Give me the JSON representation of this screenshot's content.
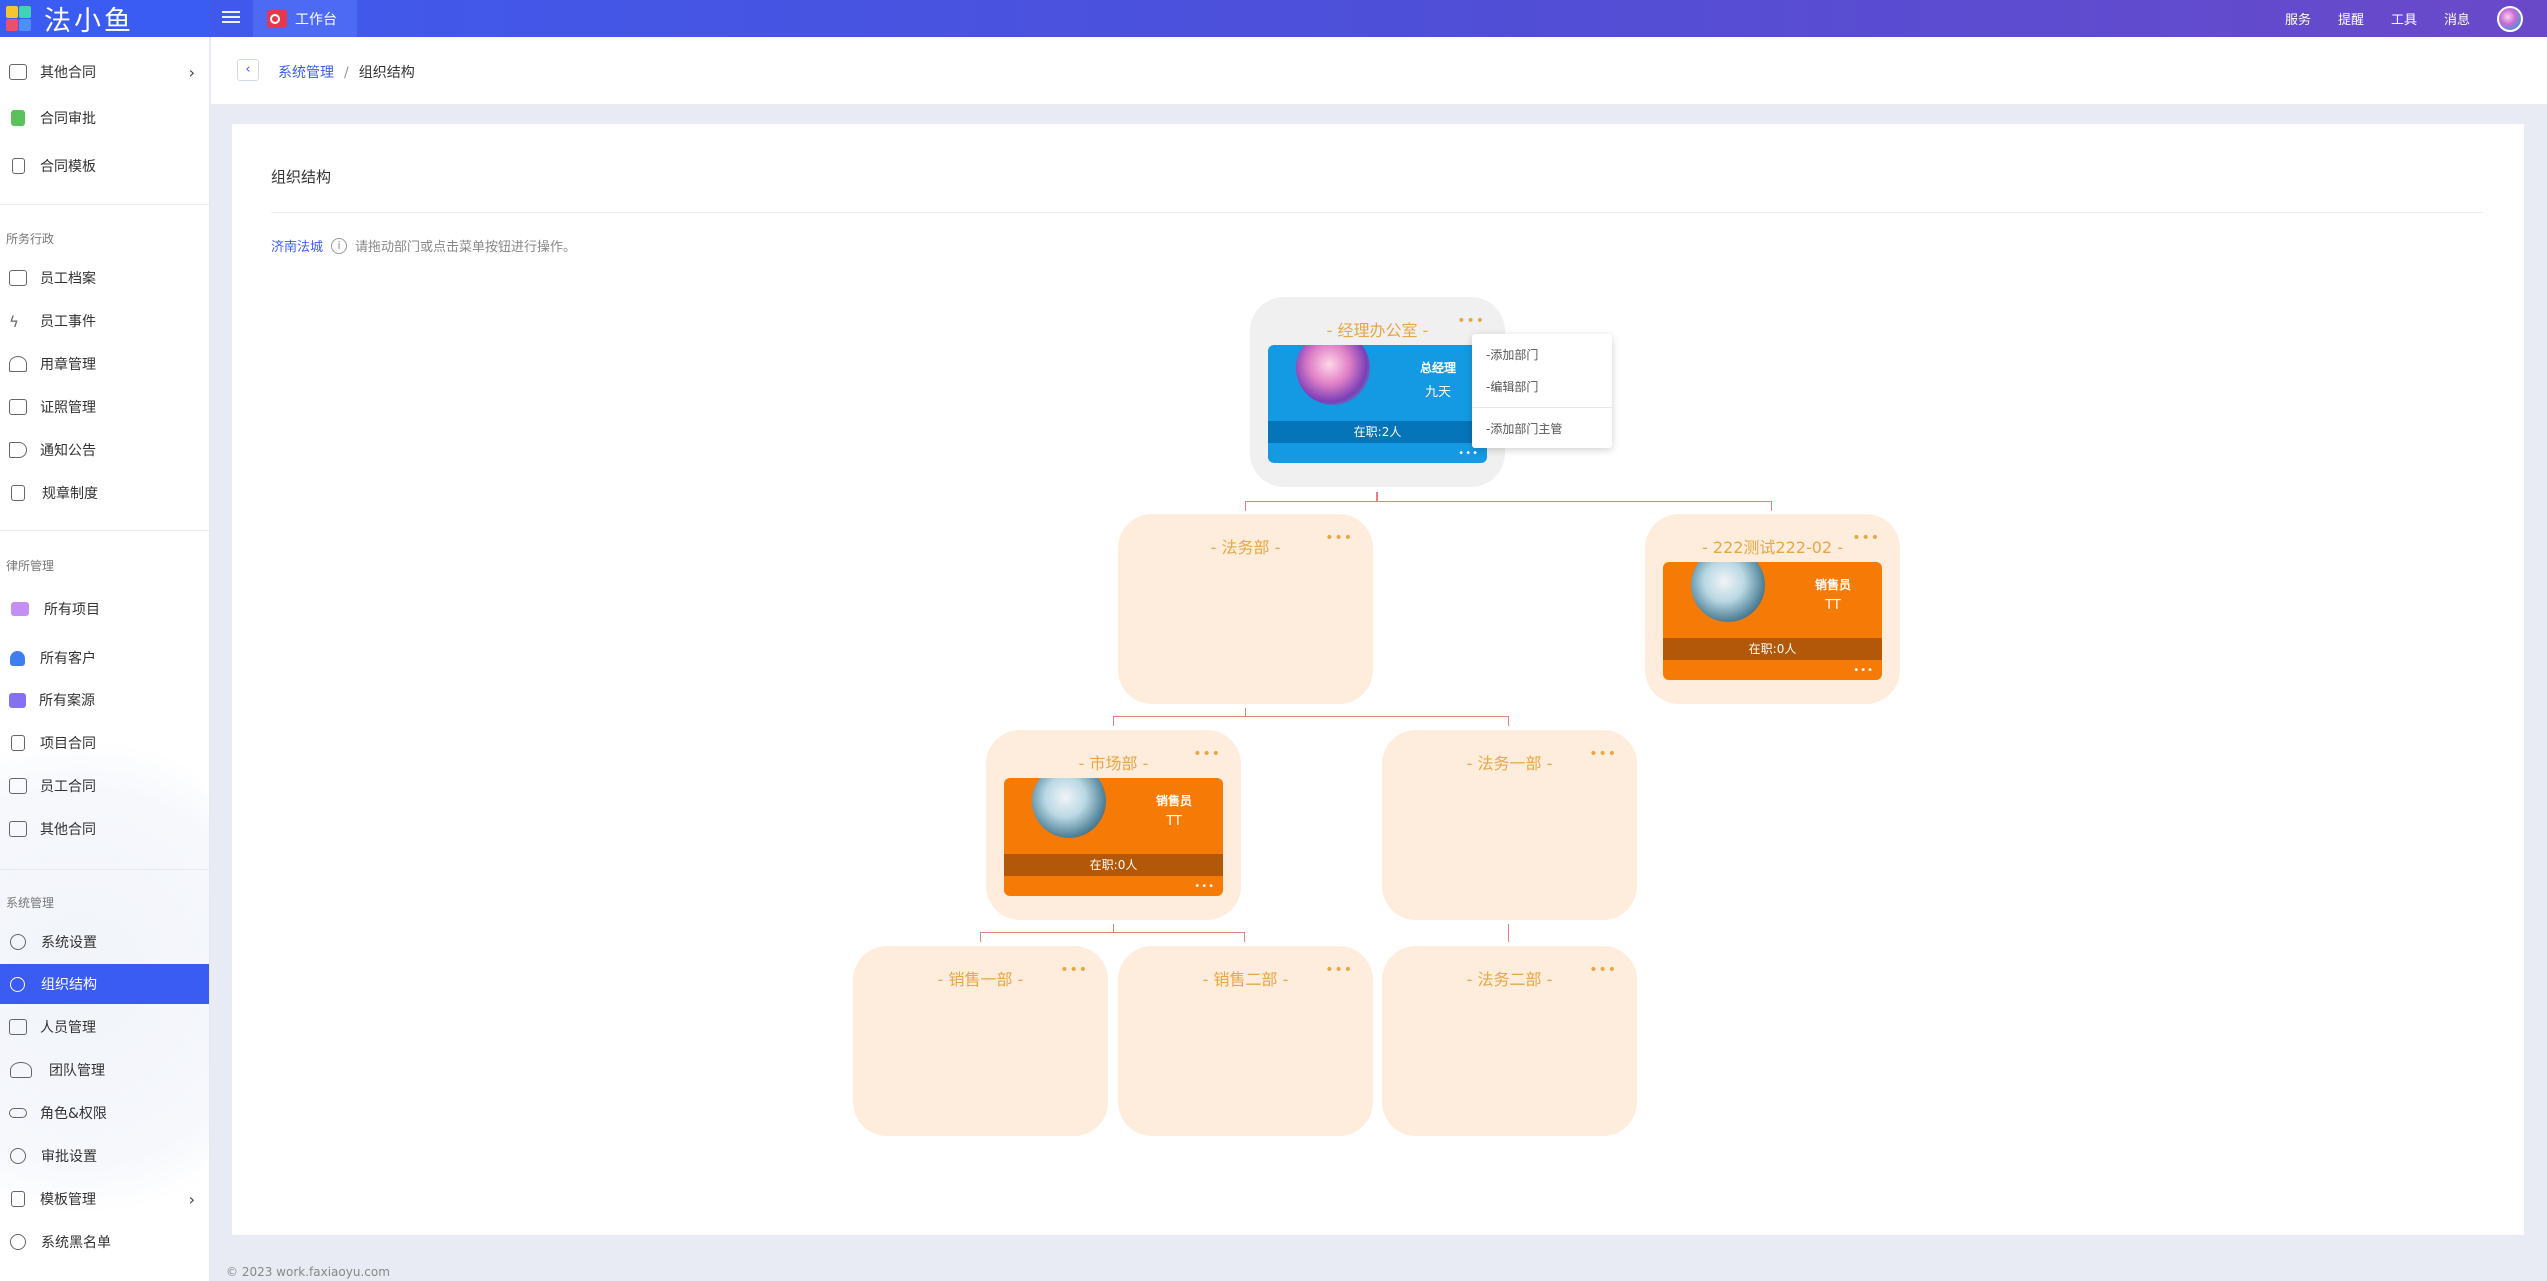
{
  "app": {
    "logo_text": "法小鱼",
    "active_tab": "工作台"
  },
  "topbar": {
    "items": [
      "服务",
      "提醒",
      "工具",
      "消息"
    ]
  },
  "sidebar": {
    "items_top": [
      {
        "label": "其他合同",
        "has_arrow": true
      },
      {
        "label": "合同审批"
      },
      {
        "label": "合同模板"
      }
    ],
    "group_admin": "所务行政",
    "items_admin": [
      {
        "label": "员工档案"
      },
      {
        "label": "员工事件"
      },
      {
        "label": "用章管理"
      },
      {
        "label": "证照管理"
      },
      {
        "label": "通知公告"
      },
      {
        "label": "规章制度"
      }
    ],
    "group_firm": "律所管理",
    "items_firm": [
      {
        "label": "所有项目"
      },
      {
        "label": "所有客户"
      },
      {
        "label": "所有案源"
      },
      {
        "label": "项目合同"
      },
      {
        "label": "员工合同"
      },
      {
        "label": "其他合同"
      }
    ],
    "group_system": "系统管理",
    "items_system": [
      {
        "label": "系统设置"
      },
      {
        "label": "组织结构",
        "active": true
      },
      {
        "label": "人员管理"
      },
      {
        "label": "团队管理"
      },
      {
        "label": "角色&权限"
      },
      {
        "label": "审批设置"
      },
      {
        "label": "模板管理",
        "has_arrow": true
      },
      {
        "label": "系统黑名单"
      }
    ]
  },
  "breadcrumb": {
    "parent": "系统管理",
    "separator": "/",
    "current": "组织结构"
  },
  "card": {
    "title": "组织结构",
    "company": "济南法城",
    "hint": "请拖动部门或点击菜单按钮进行操作。"
  },
  "org": {
    "root": {
      "name": "- 经理办公室 -",
      "role": "总经理",
      "person": "九天",
      "staff": "在职:2人"
    },
    "legal": {
      "name": "- 法务部 -"
    },
    "test": {
      "name": "- 222测试222-02 -",
      "role": "销售员",
      "person": "TT",
      "staff": "在职:0人"
    },
    "market": {
      "name": "- 市场部 -",
      "role": "销售员",
      "person": "TT",
      "staff": "在职:0人"
    },
    "legal1": {
      "name": "- 法务一部 -"
    },
    "sales1": {
      "name": "- 销售一部 -"
    },
    "sales2": {
      "name": "- 销售二部 -"
    },
    "legal2": {
      "name": "- 法务二部 -"
    },
    "dots": "•••"
  },
  "popup": {
    "add_dept": "-添加部门",
    "edit_dept": "-编辑部门",
    "add_head": "-添加部门主管"
  },
  "footer": "© 2023 work.faxiaoyu.com",
  "colors": {
    "brand": "#3b5cf2",
    "node_bg": "#feeddc",
    "root_bg": "#f0f0f0",
    "card_blue": "#149ae3",
    "card_orange": "#f67a06",
    "connector": "#e88080"
  }
}
